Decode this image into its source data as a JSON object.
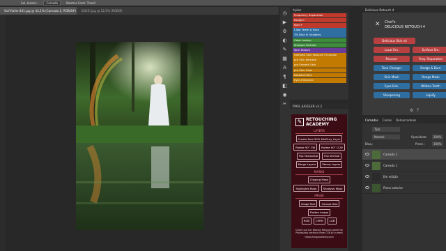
{
  "options_bar": {
    "sel_label": "Sel. Autom.:",
    "layer_box": "Camada",
    "show_transform": "Mostrar Contr. Transf."
  },
  "tabs": [
    {
      "label": "SoYVialien341.jpg @ 44,1% (Camada 2, RGB/8#)",
      "active": true
    },
    {
      "label": "(1425).jpg @ 12,5% (RGB/8)",
      "active": false
    }
  ],
  "actions": {
    "title": "Ações",
    "items": [
      {
        "label": "Frequency Separation",
        "color": "#c0392b"
      },
      {
        "label": "Dodge+",
        "color": "#c0392b"
      },
      {
        "label": "Burn+",
        "color": "#c0392b"
      },
      {
        "label": "Clear Teeth & Eyes",
        "color": "#2f6ea0"
      },
      {
        "label": "3% Blue in Shadows",
        "color": "#2f6ea0"
      },
      {
        "label": "Color Lookup",
        "color": "#3c8c3c"
      },
      {
        "label": "Sharpen Portrait",
        "color": "#3c8c3c"
      },
      {
        "label": "Skin Texture",
        "color": "#6a3c9a"
      },
      {
        "label": "Ultimate Skin Retouch FX Action",
        "color": "#c27a00"
      },
      {
        "label": "pro Skin Remake",
        "color": "#c27a00"
      },
      {
        "label": "pro Smooth Skin",
        "color": "#c27a00"
      },
      {
        "label": "pro Skin Glow",
        "color": "#c27a00"
      },
      {
        "label": "Detailed Face",
        "color": "#c27a00"
      },
      {
        "label": "Eyes Enhancer",
        "color": "#c27a00"
      }
    ]
  },
  "juggler": {
    "title": "PIXEL JUGGLER v2.2",
    "brand": "RETOUCHING",
    "brand2": "ACADEMY",
    "sections": {
      "layers": "LAYERS",
      "masks": "MASKS",
      "image": "IMAGE"
    },
    "layer_buttons": [
      [
        "Create New 50% MidGray Layer"
      ],
      [
        "Rotate 90° CW",
        "Rotate 90° CCW"
      ],
      [
        "Flip Horizontal",
        "Flip Vertical"
      ],
      [
        "Merge Layers",
        "Stamp Layers"
      ]
    ],
    "mask_buttons": [
      [
        "Clipping Mask"
      ],
      [
        "Highlights Mask",
        "Shadows Mask"
      ]
    ],
    "image_buttons": [
      [
        "Image Size",
        "Canvas Size"
      ],
      [
        "Flatten Image"
      ],
      [
        "RGB",
        "CMYK",
        "LAB"
      ]
    ],
    "footer": "Check out our Beauty Retouch panel for Photoshop versions from CS6 to current",
    "url": "retouchingacademy.com"
  },
  "delicious": {
    "title": "Delicious Retouch 4",
    "logo_top": "Chef's",
    "logo_bottom": "DELICIOUS RETOUCH 4",
    "buttons": [
      {
        "label": "Delicious Skin v4",
        "color": "#b84040",
        "wide": true
      },
      {
        "label": "Local Sm.",
        "color": "#b84040"
      },
      {
        "label": "Surface Sm.",
        "color": "#b84040"
      },
      {
        "label": "Recover",
        "color": "#b84040"
      },
      {
        "label": "Freq. Separation",
        "color": "#b84040"
      },
      {
        "label": "Tone Changer",
        "color": "#2f6ea0"
      },
      {
        "label": "Dodge & Burn",
        "color": "#2f6ea0"
      },
      {
        "label": "Skin Mask",
        "color": "#2f6ea0"
      },
      {
        "label": "Range Mask",
        "color": "#2f6ea0"
      },
      {
        "label": "Eyes Enh.",
        "color": "#2f6ea0"
      },
      {
        "label": "Whiten Teeth",
        "color": "#2f6ea0"
      },
      {
        "label": "Sharpening",
        "color": "#2f6ea0"
      },
      {
        "label": "Liquify",
        "color": "#2f6ea0"
      }
    ]
  },
  "layers": {
    "tabs": [
      "Camadas",
      "Canais",
      "Demarcadores"
    ],
    "kind": "Tipo",
    "blend": "Normal",
    "opacity_label": "Opacidade:",
    "opacity": "100%",
    "lock_label": "Bloq.:",
    "fill_label": "Preen.:",
    "fill": "100%",
    "items": [
      {
        "name": "Camada 2",
        "selected": true,
        "thumb": "#4d6a3a"
      },
      {
        "name": "Camada 1",
        "selected": false,
        "thumb": "#4d6a3a"
      },
      {
        "name": "Em edição",
        "selected": false,
        "thumb": "#2b2b2b"
      },
      {
        "name": "Plano anterior",
        "selected": false,
        "thumb": "#3a5530"
      }
    ]
  }
}
